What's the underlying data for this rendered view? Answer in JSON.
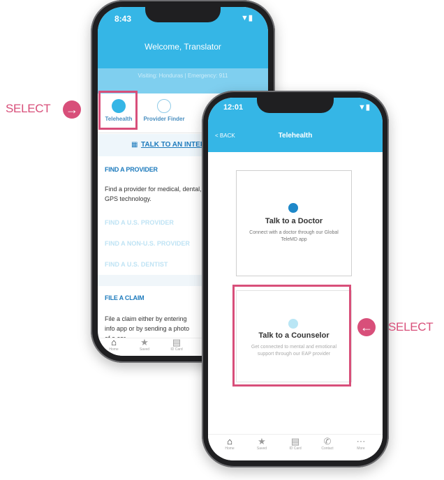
{
  "phone1": {
    "time": "8:43",
    "header_title": "Welcome, Translator",
    "subheader": "Visiting: Honduras | Emergency: 911",
    "tabs": [
      "Telehealth",
      "Provider Finder"
    ],
    "interpreter_button": "TALK TO AN INTER",
    "find_provider": {
      "title": "FIND A PROVIDER",
      "body": "Find a provider for medical, dental, and care using GPS technology.",
      "links": [
        "FIND A U.S. PROVIDER",
        "FIND A NON-U.S. PROVIDER",
        "FIND A U.S. DENTIST"
      ]
    },
    "file_claim": {
      "title": "FILE A CLAIM",
      "body": "File a claim either by entering info app or by sending a photo of a cor"
    },
    "nav": [
      "Home",
      "Saved",
      "ID Card"
    ]
  },
  "phone2": {
    "time": "12:01",
    "back_label": "< BACK",
    "title": "Telehealth",
    "card_doctor": {
      "title": "Talk to a Doctor",
      "subtitle": "Connect with a doctor through our Global TeleMD app"
    },
    "card_counselor": {
      "title": "Talk to a Counselor",
      "subtitle": "Get connected to mental and emotional support through our EAP provider"
    },
    "nav": [
      "Home",
      "Saved",
      "ID Card",
      "Contact",
      "More"
    ]
  },
  "callouts": {
    "left_select": "SELECT",
    "right_select": "SELECT"
  },
  "colors": {
    "accent": "#35b6e6",
    "highlight": "#d84f7a"
  }
}
